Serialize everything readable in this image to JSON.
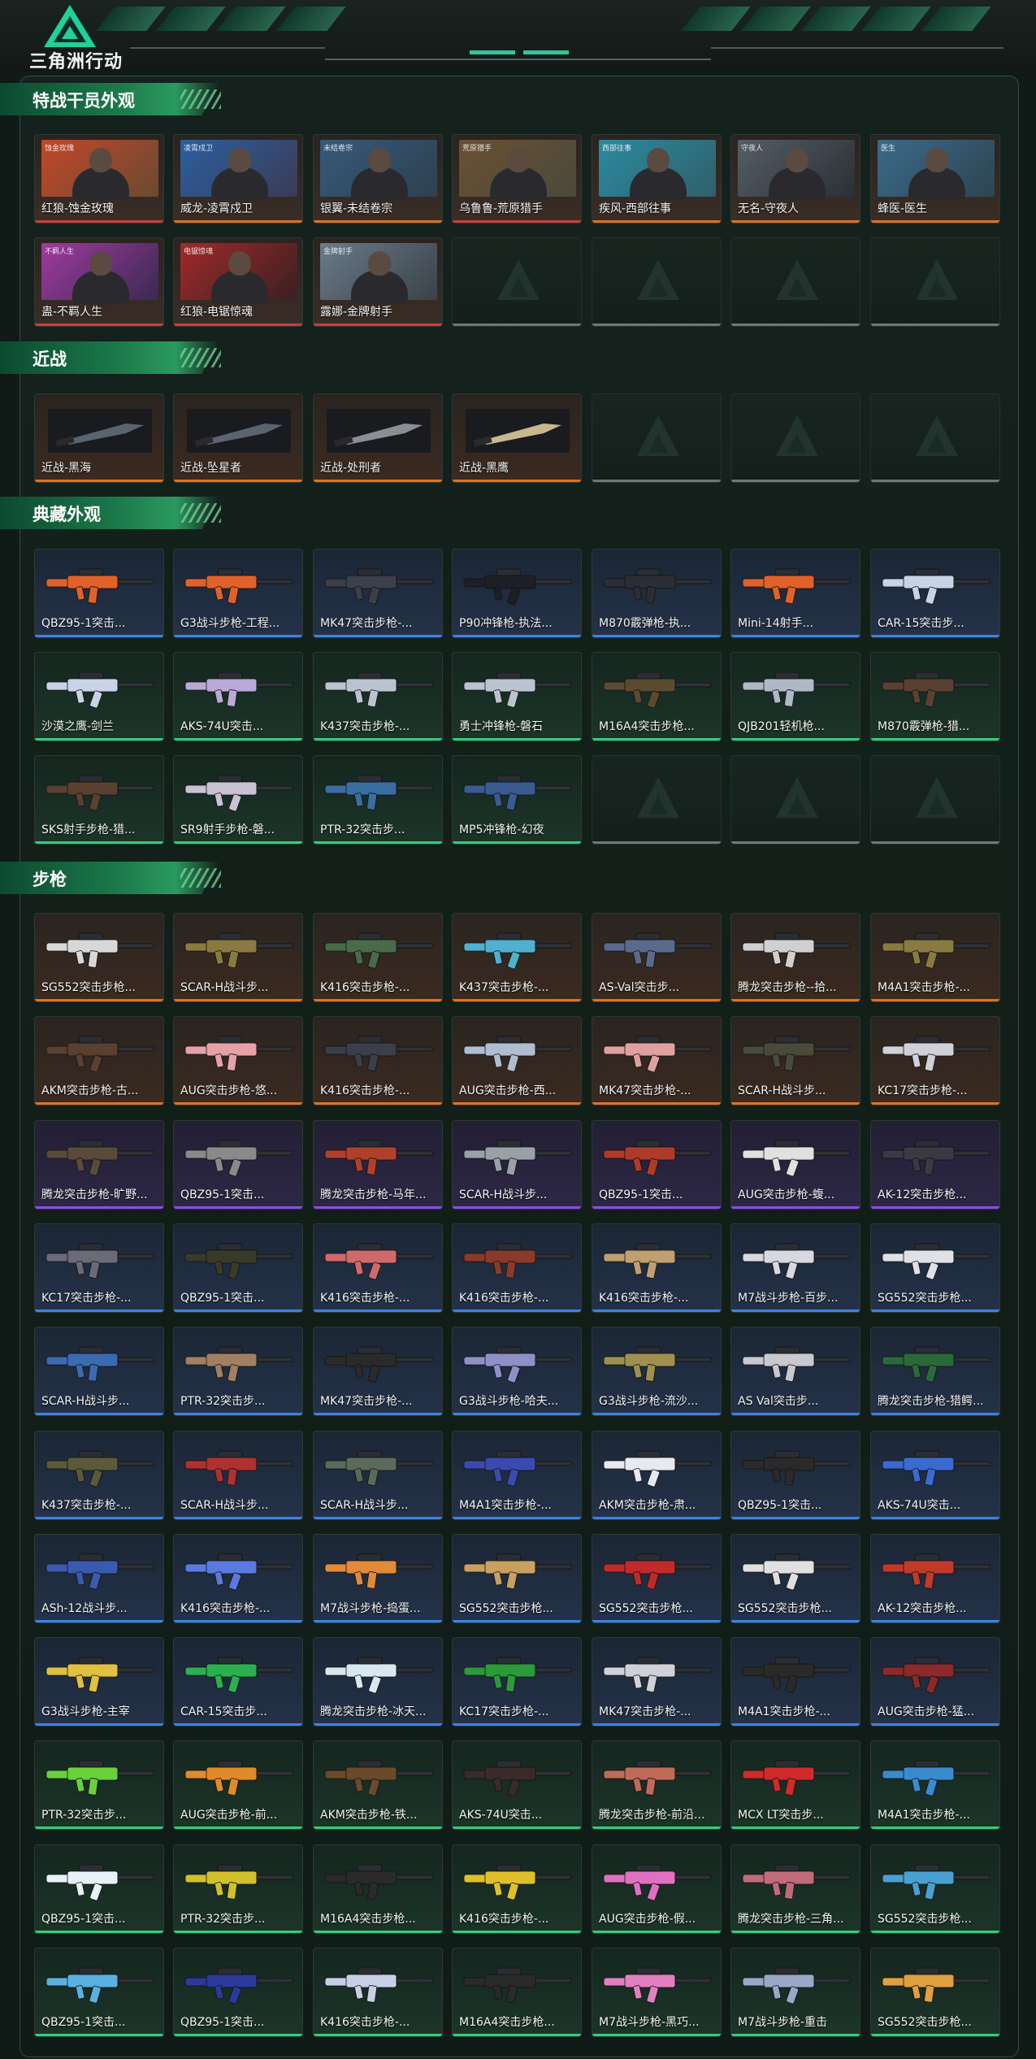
{
  "header": {
    "logo_text": "三角洲行动"
  },
  "sections": {
    "operators": {
      "title": "特战干员外观",
      "items": [
        {
          "name": "红狼-蚀金玫瑰",
          "tag": "蚀金玫瑰",
          "accent": "#c2472a",
          "bg": "#6a4a32"
        },
        {
          "name": "威龙-凌霄戍卫",
          "tag": "凌霄戍卫",
          "accent": "#2b5fa0",
          "bg": "#3b3b55"
        },
        {
          "name": "银翼-未结卷宗",
          "tag": "未结卷宗",
          "accent": "#355a7a",
          "bg": "#2f4050"
        },
        {
          "name": "乌鲁鲁-荒原猎手",
          "tag": "荒原猎手",
          "accent": "#6a5032",
          "bg": "#4a4a3a"
        },
        {
          "name": "疾风-西部往事",
          "tag": "西部往事",
          "accent": "#2a8aa0",
          "bg": "#30606a"
        },
        {
          "name": "无名-守夜人",
          "tag": "守夜人",
          "accent": "#555d66",
          "bg": "#2a3034"
        },
        {
          "name": "蜂医-医生",
          "tag": "医生",
          "accent": "#3a6a8a",
          "bg": "#2e4450"
        },
        {
          "name": "蛊-不羁人生",
          "tag": "不羁人生",
          "accent": "#a03aa0",
          "bg": "#3a2a50"
        },
        {
          "name": "红狼-电锯惊魂",
          "tag": "电锯惊魂",
          "accent": "#a02a2a",
          "bg": "#3a1f22"
        },
        {
          "name": "露娜-金牌射手",
          "tag": "金牌射手",
          "accent": "#6a7a8a",
          "bg": "#3a4248"
        }
      ]
    },
    "melee": {
      "title": "近战",
      "items": [
        "近战-黑海",
        "近战-坠星者",
        "近战-处刑者",
        "近战-黑鹰"
      ]
    },
    "collection": {
      "title": "典藏外观",
      "items": [
        {
          "name": "QBZ95-1突击...",
          "color": "#e0622a"
        },
        {
          "name": "G3战斗步枪-工程...",
          "color": "#e0622a"
        },
        {
          "name": "MK47突击步枪-...",
          "color": "#3a3f4a"
        },
        {
          "name": "P90冲锋枪-执法...",
          "color": "#1c1f26"
        },
        {
          "name": "M870霰弹枪-执...",
          "color": "#2a2d33"
        },
        {
          "name": "Mini-14射手...",
          "color": "#e0622a"
        },
        {
          "name": "CAR-15突击步...",
          "color": "#c9d3e6"
        },
        {
          "name": "沙漠之鹰-剑兰",
          "color": "#c9d3e6"
        },
        {
          "name": "AKS-74U突击...",
          "color": "#b9a9d6"
        },
        {
          "name": "K437突击步枪-...",
          "color": "#bcc3d0"
        },
        {
          "name": "勇士冲锋枪-磐石",
          "color": "#bcc3d0"
        },
        {
          "name": "M16A4突击步枪...",
          "color": "#5a4a30"
        },
        {
          "name": "QJB201轻机枪...",
          "color": "#b0b8c6"
        },
        {
          "name": "M870霰弹枪-猎...",
          "color": "#5a4030"
        },
        {
          "name": "SKS射手步枪-猎...",
          "color": "#5a4030"
        },
        {
          "name": "SR9射手步枪-磐...",
          "color": "#c7c3d3"
        },
        {
          "name": "PTR-32突击步...",
          "color": "#3a6ea0"
        },
        {
          "name": "MP5冲锋枪-幻夜",
          "color": "#3a5a90"
        }
      ]
    },
    "rifles": {
      "title": "步枪",
      "items": [
        {
          "name": "SG552突击步枪...",
          "color": "#d8d8d8",
          "rarity": "orange"
        },
        {
          "name": "SCAR-H战斗步...",
          "color": "#8a7a40",
          "rarity": "orange"
        },
        {
          "name": "K416突击步枪-...",
          "color": "#4a6a4a",
          "rarity": "orange"
        },
        {
          "name": "K437突击步枪-...",
          "color": "#4fb0d0",
          "rarity": "orange"
        },
        {
          "name": "AS-Val突击步...",
          "color": "#5a6a8a",
          "rarity": "orange"
        },
        {
          "name": "腾龙突击步枪--拾...",
          "color": "#d0d0d0",
          "rarity": "orange"
        },
        {
          "name": "M4A1突击步枪-...",
          "color": "#8a7a40",
          "rarity": "orange"
        },
        {
          "name": "AKM突击步枪-古...",
          "color": "#5a4030",
          "rarity": "orange"
        },
        {
          "name": "AUG突击步枪-悠...",
          "color": "#e8a0a8",
          "rarity": "orange"
        },
        {
          "name": "K416突击步枪-...",
          "color": "#3a3f4a",
          "rarity": "orange"
        },
        {
          "name": "AUG突击步枪-西...",
          "color": "#b0bcd0",
          "rarity": "orange"
        },
        {
          "name": "MK47突击步枪-...",
          "color": "#e0a0a0",
          "rarity": "orange"
        },
        {
          "name": "SCAR-H战斗步...",
          "color": "#4a4a3a",
          "rarity": "orange"
        },
        {
          "name": "KC17突击步枪-...",
          "color": "#d0d0d8",
          "rarity": "orange"
        },
        {
          "name": "腾龙突击步枪-旷野...",
          "color": "#5a4a3a",
          "rarity": "purple"
        },
        {
          "name": "QBZ95-1突击...",
          "color": "#8a8a8a",
          "rarity": "purple"
        },
        {
          "name": "腾龙突击步枪-马年...",
          "color": "#b0402a",
          "rarity": "purple"
        },
        {
          "name": "SCAR-H战斗步...",
          "color": "#9aa0a8",
          "rarity": "purple"
        },
        {
          "name": "QBZ95-1突击...",
          "color": "#b03a2a",
          "rarity": "purple"
        },
        {
          "name": "AUG突击步枪-蝮...",
          "color": "#e0e0e0",
          "rarity": "purple"
        },
        {
          "name": "AK-12突击步枪...",
          "color": "#3a3a44",
          "rarity": "purple"
        },
        {
          "name": "KC17突击步枪-...",
          "color": "#6a6a78",
          "rarity": "blue"
        },
        {
          "name": "QBZ95-1突击...",
          "color": "#3a3a2a",
          "rarity": "blue"
        },
        {
          "name": "K416突击步枪-...",
          "color": "#d06a6a",
          "rarity": "blue"
        },
        {
          "name": "K416突击步枪-...",
          "color": "#8a3a2a",
          "rarity": "blue"
        },
        {
          "name": "K416突击步枪-...",
          "color": "#c0a070",
          "rarity": "blue"
        },
        {
          "name": "M7战斗步枪-百步...",
          "color": "#d8d8e0",
          "rarity": "blue"
        },
        {
          "name": "SG552突击步枪...",
          "color": "#e0e0e8",
          "rarity": "blue"
        },
        {
          "name": "SCAR-H战斗步...",
          "color": "#3a6ab0",
          "rarity": "blue"
        },
        {
          "name": "PTR-32突击步...",
          "color": "#a08060",
          "rarity": "blue"
        },
        {
          "name": "MK47突击步枪-...",
          "color": "#2a2a2a",
          "rarity": "blue"
        },
        {
          "name": "G3战斗步枪-哈夫...",
          "color": "#9090c8",
          "rarity": "blue"
        },
        {
          "name": "G3战斗步枪-流沙...",
          "color": "#a09050",
          "rarity": "blue"
        },
        {
          "name": "AS Val突击步...",
          "color": "#c8c8d0",
          "rarity": "blue"
        },
        {
          "name": "腾龙突击步枪-猎鳄...",
          "color": "#2a6a3a",
          "rarity": "blue"
        },
        {
          "name": "K437突击步枪-...",
          "color": "#5a5a3a",
          "rarity": "blue"
        },
        {
          "name": "SCAR-H战斗步...",
          "color": "#b03030",
          "rarity": "blue"
        },
        {
          "name": "SCAR-H战斗步...",
          "color": "#5a6a5a",
          "rarity": "blue"
        },
        {
          "name": "M4A1突击步枪-...",
          "color": "#3a4ab0",
          "rarity": "blue"
        },
        {
          "name": "AKM突击步枪-肃...",
          "color": "#e8e8f0",
          "rarity": "blue"
        },
        {
          "name": "QBZ95-1突击...",
          "color": "#2a2a2a",
          "rarity": "blue"
        },
        {
          "name": "AKS-74U突击...",
          "color": "#3a6ad0",
          "rarity": "blue"
        },
        {
          "name": "ASh-12战斗步...",
          "color": "#3a5ab0",
          "rarity": "blue"
        },
        {
          "name": "K416突击步枪-...",
          "color": "#5a7ae0",
          "rarity": "blue"
        },
        {
          "name": "M7战斗步枪-捣蛋...",
          "color": "#e08a3a",
          "rarity": "blue"
        },
        {
          "name": "SG552突击步枪...",
          "color": "#c8a060",
          "rarity": "blue"
        },
        {
          "name": "SG552突击步枪...",
          "color": "#c02a2a",
          "rarity": "blue"
        },
        {
          "name": "SG552突击步枪...",
          "color": "#e0e0e0",
          "rarity": "blue"
        },
        {
          "name": "AK-12突击步枪...",
          "color": "#c03a2a",
          "rarity": "blue"
        },
        {
          "name": "G3战斗步枪-主宰",
          "color": "#e0c040",
          "rarity": "blue"
        },
        {
          "name": "CAR-15突击步...",
          "color": "#2ab050",
          "rarity": "blue"
        },
        {
          "name": "腾龙突击步枪-冰天...",
          "color": "#d8e8f0",
          "rarity": "blue"
        },
        {
          "name": "KC17突击步枪-...",
          "color": "#2a9a3a",
          "rarity": "blue"
        },
        {
          "name": "MK47突击步枪-...",
          "color": "#d0d0d8",
          "rarity": "blue"
        },
        {
          "name": "M4A1突击步枪-...",
          "color": "#2a2a2a",
          "rarity": "blue"
        },
        {
          "name": "AUG突击步枪-猛...",
          "color": "#8a2a2a",
          "rarity": "blue"
        },
        {
          "name": "PTR-32突击步...",
          "color": "#6ad03a",
          "rarity": "green"
        },
        {
          "name": "AUG突击步枪-前...",
          "color": "#e08a2a",
          "rarity": "green"
        },
        {
          "name": "AKM突击步枪-铁...",
          "color": "#6a4a2a",
          "rarity": "green"
        },
        {
          "name": "AKS-74U突击...",
          "color": "#3a2a2a",
          "rarity": "green"
        },
        {
          "name": "腾龙突击步枪-前沿...",
          "color": "#c06a5a",
          "rarity": "green"
        },
        {
          "name": "MCX LT突击步...",
          "color": "#d02a2a",
          "rarity": "green"
        },
        {
          "name": "M4A1突击步枪-...",
          "color": "#3a8ad0",
          "rarity": "green"
        },
        {
          "name": "QBZ95-1突击...",
          "color": "#e8f0f8",
          "rarity": "green"
        },
        {
          "name": "PTR-32突击步...",
          "color": "#d0c02a",
          "rarity": "green"
        },
        {
          "name": "M16A4突击步枪...",
          "color": "#2a2a2a",
          "rarity": "green"
        },
        {
          "name": "K416突击步枪-...",
          "color": "#e0c02a",
          "rarity": "green"
        },
        {
          "name": "AUG突击步枪-假...",
          "color": "#e070c0",
          "rarity": "green"
        },
        {
          "name": "腾龙突击步枪-三角...",
          "color": "#c06a7a",
          "rarity": "green"
        },
        {
          "name": "SG552突击步枪...",
          "color": "#4aa0d0",
          "rarity": "green"
        },
        {
          "name": "QBZ95-1突击...",
          "color": "#5ab0e0",
          "rarity": "green"
        },
        {
          "name": "QBZ95-1突击...",
          "color": "#2a3a9a",
          "rarity": "green"
        },
        {
          "name": "K416突击步枪-...",
          "color": "#c8d0e8",
          "rarity": "green"
        },
        {
          "name": "M16A4突击步枪...",
          "color": "#2a2a2a",
          "rarity": "green"
        },
        {
          "name": "M7战斗步枪-黑巧...",
          "color": "#e080c0",
          "rarity": "green"
        },
        {
          "name": "M7战斗步枪-重击",
          "color": "#9aa8c8",
          "rarity": "green"
        },
        {
          "name": "SG552突击步枪...",
          "color": "#e0a040",
          "rarity": "green"
        }
      ]
    }
  }
}
